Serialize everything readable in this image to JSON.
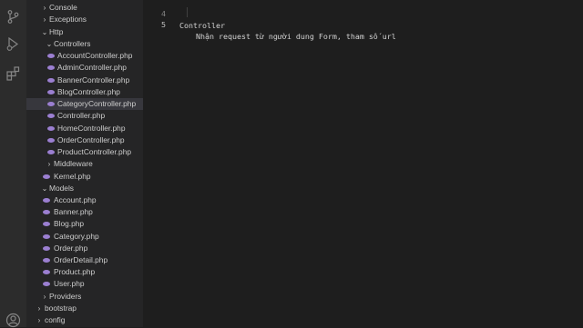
{
  "activity_bar": {
    "icons": [
      "source-control-icon",
      "run-debug-icon",
      "extensions-icon",
      "account-icon"
    ]
  },
  "explorer": {
    "items": [
      {
        "label": "Console",
        "kind": "folder",
        "expanded": false
      },
      {
        "label": "Exceptions",
        "kind": "folder",
        "expanded": false
      },
      {
        "label": "Http",
        "kind": "folder",
        "expanded": true
      },
      {
        "label": "Controllers",
        "kind": "folder",
        "expanded": true
      },
      {
        "label": "AccountController.php",
        "kind": "php"
      },
      {
        "label": "AdminController.php",
        "kind": "php"
      },
      {
        "label": "BannerController.php",
        "kind": "php"
      },
      {
        "label": "BlogController.php",
        "kind": "php"
      },
      {
        "label": "CategoryController.php",
        "kind": "php",
        "selected": true
      },
      {
        "label": "Controller.php",
        "kind": "php"
      },
      {
        "label": "HomeController.php",
        "kind": "php"
      },
      {
        "label": "OrderController.php",
        "kind": "php"
      },
      {
        "label": "ProductController.php",
        "kind": "php"
      },
      {
        "label": "Middleware",
        "kind": "folder",
        "expanded": false
      },
      {
        "label": "Kernel.php",
        "kind": "php"
      },
      {
        "label": "Models",
        "kind": "folder",
        "expanded": true
      },
      {
        "label": "Account.php",
        "kind": "php"
      },
      {
        "label": "Banner.php",
        "kind": "php"
      },
      {
        "label": "Blog.php",
        "kind": "php"
      },
      {
        "label": "Category.php",
        "kind": "php"
      },
      {
        "label": "Order.php",
        "kind": "php"
      },
      {
        "label": "OrderDetail.php",
        "kind": "php"
      },
      {
        "label": "Product.php",
        "kind": "php"
      },
      {
        "label": "User.php",
        "kind": "php"
      },
      {
        "label": "Providers",
        "kind": "folder",
        "expanded": false
      },
      {
        "label": "bootstrap",
        "kind": "folder",
        "expanded": false
      },
      {
        "label": "config",
        "kind": "folder",
        "expanded": false
      }
    ]
  },
  "editor": {
    "lines": [
      {
        "number": "4",
        "text": "Controller"
      },
      {
        "number": "5",
        "text": "Nhận request từ người dung Form, tham số url",
        "current": true
      }
    ]
  },
  "colors": {
    "activity_bar_bg": "#2c2c2c",
    "sidebar_bg": "#252526",
    "editor_bg": "#1e1e1e",
    "selection_bg": "#37373d",
    "php_icon": "#9b7fd1",
    "line_number": "#858585"
  }
}
